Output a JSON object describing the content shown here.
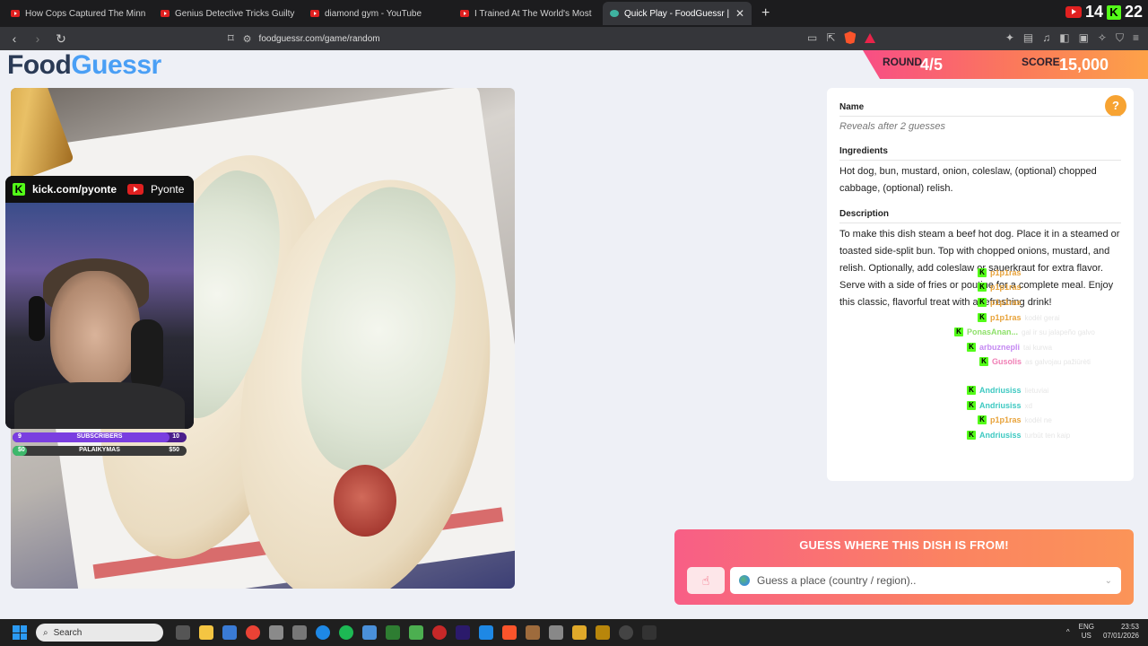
{
  "browser": {
    "tabs": [
      {
        "label": "How Cops Captured The Minnesota",
        "active": false
      },
      {
        "label": "Genius Detective Tricks Guilty Suspe",
        "active": false
      },
      {
        "label": "diamond gym - YouTube",
        "active": false
      },
      {
        "label": "I Trained At The World's Most Dange",
        "active": false
      },
      {
        "label": "Quick Play - FoodGuessr | FoodG",
        "active": true
      }
    ],
    "new_tab": "+",
    "close_tab": "✕",
    "url": "foodguessr.com/game/random",
    "counter_a": "14",
    "counter_b": "22"
  },
  "logo": {
    "part1": "Food",
    "part2": "Guessr"
  },
  "round": {
    "label": "ROUND",
    "value": "4/5"
  },
  "score": {
    "label": "SCORE",
    "value": "15,000"
  },
  "overlay": {
    "kick_handle": "kick.com/pyonte",
    "yt_name": "Pyonte",
    "subs": {
      "left": "9",
      "label": "SUBSCRIBERS",
      "right": "10",
      "progress": 0.9
    },
    "donations": {
      "left": "$0",
      "label": "PALAIKYMAS",
      "right": "$50",
      "progress": 0.0
    }
  },
  "info": {
    "help": "?",
    "name_title": "Name",
    "name_text": "Reveals after 2 guesses",
    "ingredients_title": "Ingredients",
    "ingredients_text": "Hot dog, bun, mustard, onion, coleslaw, (optional) chopped cabbage, (optional) relish.",
    "description_title": "Description",
    "description_text": "To make this dish steam a beef hot dog. Place it in a steamed or toasted side-split bun. Top with chopped onions, mustard, and relish. Optionally, add coleslaw or sauerkraut for extra flavor. Serve with a side of fries or poutine for a complete meal. Enjoy this classic, flavorful treat with a refreshing drink!"
  },
  "chat": [
    {
      "user": "p1p1ras",
      "color": "#e8a33a",
      "msg": ""
    },
    {
      "user": "p1p1ras",
      "color": "#e8a33a",
      "msg": ""
    },
    {
      "user": "p1p1ras",
      "color": "#e8a33a",
      "msg": ""
    },
    {
      "user": "p1p1ras",
      "color": "#e8a33a",
      "msg": "kodėl gerai"
    },
    {
      "user": "PonasAnan...",
      "color": "#8ee06a",
      "msg": "gal ir su jalapeño galvo"
    },
    {
      "user": "arbuznepli",
      "color": "#c58af2",
      "msg": "tai kurwa"
    },
    {
      "user": "Gusolis",
      "color": "#f07fb5",
      "msg": "as galvojau pažiūrėti"
    },
    {
      "user": "Andriusiss",
      "color": "#3ec9c2",
      "msg": "lietuviai"
    },
    {
      "user": "Andriusiss",
      "color": "#3ec9c2",
      "msg": "xd"
    },
    {
      "user": "p1p1ras",
      "color": "#e8a33a",
      "msg": "kodėl ne"
    },
    {
      "user": "Andriusiss",
      "color": "#3ec9c2",
      "msg": "turbūt ten kaip"
    }
  ],
  "guess": {
    "title": "GUESS WHERE THIS DISH IS FROM!",
    "placeholder": "Guess a place (country / region).."
  },
  "taskbar": {
    "search": "Search",
    "lang1": "ENG",
    "lang2": "US",
    "time": "23:53",
    "date": "07/01/2026"
  }
}
